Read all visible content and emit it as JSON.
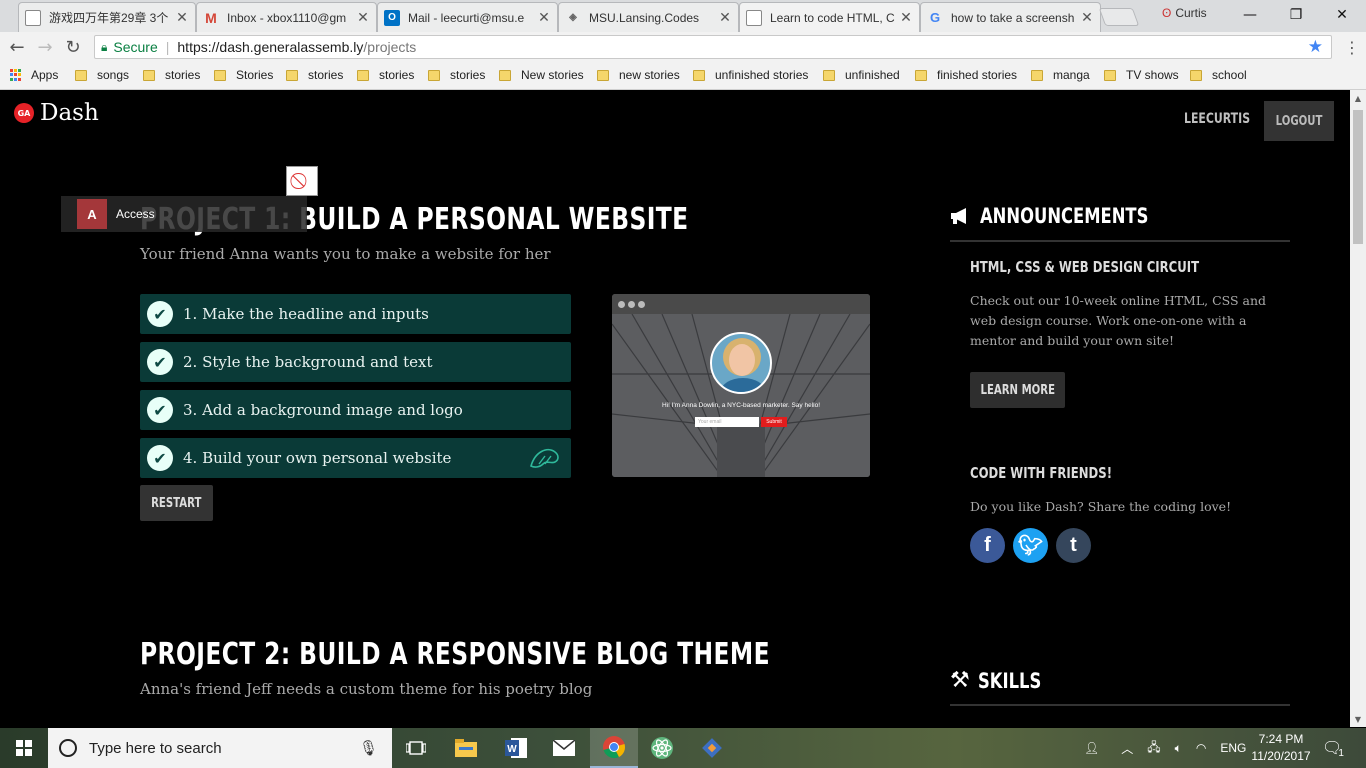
{
  "browser": {
    "tabs": [
      {
        "label": "游戏四万年第29章 3个",
        "icon": "page-icon",
        "color": "#777777"
      },
      {
        "label": "Inbox - xbox1110@gm",
        "icon": "gmail-icon",
        "color": "#d44638"
      },
      {
        "label": "Mail - leecurti@msu.e",
        "icon": "outlook-icon",
        "color": "#0072c6"
      },
      {
        "label": "MSU.Lansing.Codes",
        "icon": "codes-icon",
        "color": "#777777"
      },
      {
        "label": "Learn to code HTML, C",
        "icon": "page-icon",
        "color": "#777777",
        "active": true
      },
      {
        "label": "how to take a screensh",
        "icon": "google-icon",
        "color": "#4285f4"
      }
    ],
    "profile_name": "Curtis",
    "window_controls": {
      "minimize": "—",
      "maximize": "❐",
      "close": "✕"
    },
    "secure_label": "Secure",
    "url_host": "https://dash.generalassemb.ly",
    "url_path": "/projects",
    "bookmarks": [
      "Apps",
      "songs",
      "stories",
      "Stories",
      "stories",
      "stories",
      "stories",
      "New stories",
      "new stories",
      "unfinished stories",
      "unfinished",
      "finished stories",
      "manga",
      "TV shows",
      "school"
    ]
  },
  "site": {
    "logo_badge": "GA",
    "logo_name": "Dash",
    "username": "LEECURTIS",
    "logout_label": "LOGOUT"
  },
  "overlay": {
    "access_label": "Access",
    "access_icon_letter": "A"
  },
  "projects": [
    {
      "title": "PROJECT 1: BUILD A PERSONAL WEBSITE",
      "subtitle": "Your friend Anna wants you to make a website for her",
      "steps": [
        "1. Make the headline and inputs",
        "2. Style the background and text",
        "3. Add a background image and logo",
        "4. Build your own personal website"
      ],
      "restart_label": "RESTART",
      "preview": {
        "greeting": "Hi! I'm Anna Dowlin, a NYC-based marketer. Say hello!",
        "email_placeholder": "Your email",
        "submit_label": "Submit"
      }
    },
    {
      "title": "PROJECT 2: BUILD A RESPONSIVE BLOG THEME",
      "subtitle": "Anna's friend Jeff needs a custom theme for his poetry blog"
    }
  ],
  "sidebar": {
    "announcements_heading": "ANNOUNCEMENTS",
    "circuit_title": "HTML, CSS & WEB DESIGN CIRCUIT",
    "circuit_text": "Check out our 10-week online HTML, CSS and web design course. Work one-on-one with a mentor and build your own site!",
    "learn_more_label": "LEARN MORE",
    "friends_title": "CODE WITH FRIENDS!",
    "friends_text": "Do you like Dash? Share the coding love!",
    "social": [
      {
        "name": "facebook",
        "glyph": "f",
        "color": "#3b5998"
      },
      {
        "name": "twitter",
        "glyph": "t",
        "color": "#1da1f2"
      },
      {
        "name": "tumblr",
        "glyph": "t",
        "color": "#35465c"
      }
    ],
    "skills_heading": "SKILLS"
  },
  "taskbar": {
    "search_placeholder": "Type here to search",
    "language": "ENG",
    "time": "7:24 PM",
    "date": "11/20/2017",
    "notification_count": "1"
  }
}
